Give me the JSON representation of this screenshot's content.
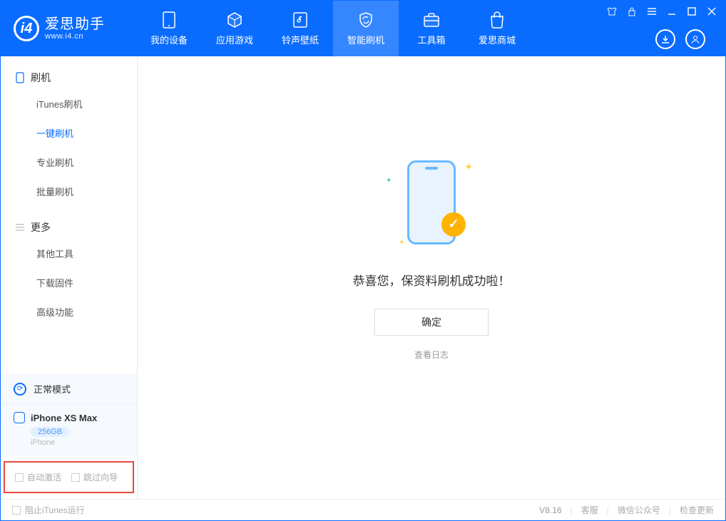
{
  "app": {
    "logo_title": "爱思助手",
    "logo_sub": "www.i4.cn"
  },
  "nav": [
    {
      "label": "我的设备"
    },
    {
      "label": "应用游戏"
    },
    {
      "label": "铃声壁纸"
    },
    {
      "label": "智能刷机"
    },
    {
      "label": "工具箱"
    },
    {
      "label": "爱思商城"
    }
  ],
  "sidebar": {
    "section1_title": "刷机",
    "section1_items": [
      "iTunes刷机",
      "一键刷机",
      "专业刷机",
      "批量刷机"
    ],
    "section2_title": "更多",
    "section2_items": [
      "其他工具",
      "下载固件",
      "高级功能"
    ]
  },
  "mode": {
    "label": "正常模式"
  },
  "device": {
    "name": "iPhone XS Max",
    "storage": "256GB",
    "type": "iPhone"
  },
  "checkboxes": {
    "auto_activate": "自动激活",
    "skip_guide": "跳过向导"
  },
  "main": {
    "success_text": "恭喜您，保资料刷机成功啦！",
    "confirm_label": "确定",
    "view_log": "查看日志"
  },
  "footer": {
    "block_itunes": "阻止iTunes运行",
    "version": "V8.16",
    "links": [
      "客服",
      "微信公众号",
      "检查更新"
    ]
  }
}
